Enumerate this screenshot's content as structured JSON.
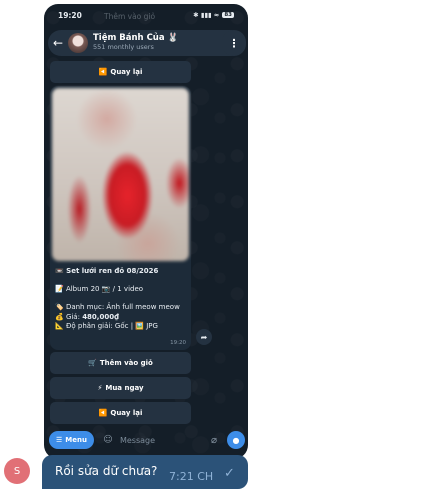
{
  "status_bar": {
    "time": "19:20",
    "ghost_text": "Thêm vào giỏ",
    "indicators": "✱ ▮▮▮ ≈",
    "battery": "83"
  },
  "chat_header": {
    "name": "Tiệm Bánh Của 🐰",
    "subtitle": "551 monthly users"
  },
  "top_button": {
    "icon": "◀️",
    "label": "Quay lại"
  },
  "post": {
    "title": "📼 Set lưới ren đỏ 08/2026",
    "album": "📝 Album 20 📷 / 1 video",
    "category": "🏷️ Danh mục: Ảnh full meow meow",
    "price_label": "💰 Giá: ",
    "price_value": "480,000₫",
    "resolution": "📐 Độ phân giải: Gốc | 🖼️ JPG",
    "time": "19:20"
  },
  "keyboard_buttons": [
    {
      "icon": "🛒",
      "label": "Thêm vào giỏ"
    },
    {
      "icon": "⚡",
      "label": "Mua ngay"
    },
    {
      "icon": "◀️",
      "label": "Quay lại"
    }
  ],
  "composer": {
    "menu_label": "Menu",
    "placeholder": "Message"
  },
  "outer_message": {
    "avatar_letter": "S",
    "text": "Rồi sửa dữ chưa?",
    "time": "7:21 CH"
  },
  "colors": {
    "phone_bg": "#141e28",
    "button_bg": "#243241",
    "accent_blue": "#3d8de8",
    "outgoing_bubble": "#2b5278",
    "avatar_bg": "#e17076"
  }
}
